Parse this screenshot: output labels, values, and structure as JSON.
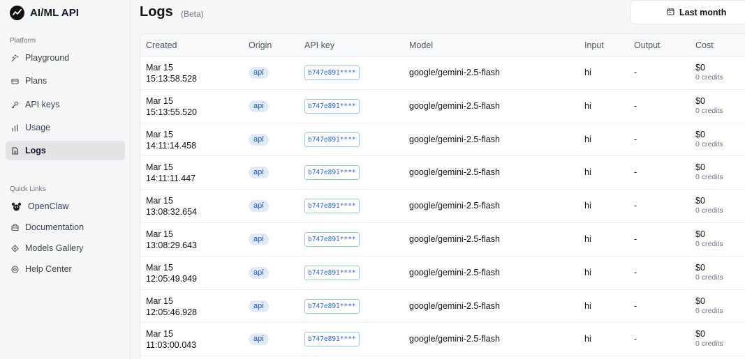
{
  "brand": {
    "name": "AI/ML API"
  },
  "sidebar": {
    "platform_label": "Platform",
    "platform_items": [
      {
        "label": "Playground",
        "icon": "playground-icon"
      },
      {
        "label": "Plans",
        "icon": "plans-icon"
      },
      {
        "label": "API keys",
        "icon": "key-icon"
      },
      {
        "label": "Usage",
        "icon": "bar-chart-icon"
      },
      {
        "label": "Logs",
        "icon": "file-icon",
        "active": true
      }
    ],
    "quick_links_label": "Quick Links",
    "quick_links": [
      {
        "label": "OpenClaw",
        "icon": "openclaw-icon"
      },
      {
        "label": "Documentation",
        "icon": "documentation-icon"
      },
      {
        "label": "Models Gallery",
        "icon": "models-icon"
      },
      {
        "label": "Help Center",
        "icon": "help-icon"
      }
    ]
  },
  "header": {
    "title": "Logs",
    "badge": "(Beta)",
    "range_label": "Last month"
  },
  "table": {
    "columns": [
      "Created",
      "Origin",
      "API key",
      "Model",
      "Input",
      "Output",
      "Cost"
    ],
    "rows": [
      {
        "date": "Mar 15",
        "time": "15:13:58.528",
        "origin": "api",
        "key": "b747e891****",
        "model": "google/gemini-2.5-flash",
        "input": "hi",
        "output": "-",
        "cost": "$0",
        "credits": "0 credits"
      },
      {
        "date": "Mar 15",
        "time": "15:13:55.520",
        "origin": "api",
        "key": "b747e891****",
        "model": "google/gemini-2.5-flash",
        "input": "hi",
        "output": "-",
        "cost": "$0",
        "credits": "0 credits"
      },
      {
        "date": "Mar 15",
        "time": "14:11:14.458",
        "origin": "api",
        "key": "b747e891****",
        "model": "google/gemini-2.5-flash",
        "input": "hi",
        "output": "-",
        "cost": "$0",
        "credits": "0 credits"
      },
      {
        "date": "Mar 15",
        "time": "14:11:11.447",
        "origin": "api",
        "key": "b747e891****",
        "model": "google/gemini-2.5-flash",
        "input": "hi",
        "output": "-",
        "cost": "$0",
        "credits": "0 credits"
      },
      {
        "date": "Mar 15",
        "time": "13:08:32.654",
        "origin": "api",
        "key": "b747e891****",
        "model": "google/gemini-2.5-flash",
        "input": "hi",
        "output": "-",
        "cost": "$0",
        "credits": "0 credits"
      },
      {
        "date": "Mar 15",
        "time": "13:08:29.643",
        "origin": "api",
        "key": "b747e891****",
        "model": "google/gemini-2.5-flash",
        "input": "hi",
        "output": "-",
        "cost": "$0",
        "credits": "0 credits"
      },
      {
        "date": "Mar 15",
        "time": "12:05:49.949",
        "origin": "api",
        "key": "b747e891****",
        "model": "google/gemini-2.5-flash",
        "input": "hi",
        "output": "-",
        "cost": "$0",
        "credits": "0 credits"
      },
      {
        "date": "Mar 15",
        "time": "12:05:46.928",
        "origin": "api",
        "key": "b747e891****",
        "model": "google/gemini-2.5-flash",
        "input": "hi",
        "output": "-",
        "cost": "$0",
        "credits": "0 credits"
      },
      {
        "date": "Mar 15",
        "time": "11:03:00.043",
        "origin": "api",
        "key": "b747e891****",
        "model": "google/gemini-2.5-flash",
        "input": "hi",
        "output": "-",
        "cost": "$0",
        "credits": "0 credits"
      }
    ]
  },
  "colors": {
    "accent": "#1d4ed8",
    "pill_bg": "#e0ecfd",
    "active_nav_bg": "#e4e4e7"
  }
}
